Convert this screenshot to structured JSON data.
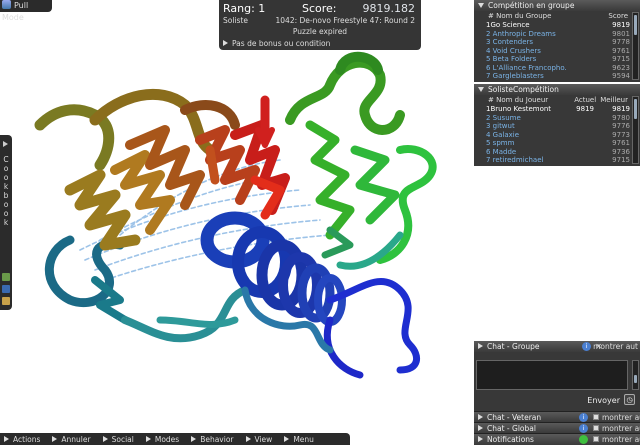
{
  "pull_mode": {
    "label": "Pull Mode"
  },
  "score_panel": {
    "rank": "Rang: 1",
    "score_label": "Score:",
    "score_value": "9819.182",
    "mode": "Soliste",
    "puzzle": "1042: De-novo Freestyle 47: Round 2",
    "status": "Puzzle expired",
    "bonus": "Pas de bonus ou condition"
  },
  "group_competition": {
    "title": "Compétition en groupe",
    "col_name": "# Nom du Groupe",
    "col_score": "Score",
    "rows": [
      {
        "name": "1Go Science",
        "score": "9819"
      },
      {
        "name": "2 Anthropic Dreams",
        "score": "9801"
      },
      {
        "name": "3 Contenders",
        "score": "9778"
      },
      {
        "name": "4 Void Crushers",
        "score": "9761"
      },
      {
        "name": "5 Beta Folders",
        "score": "9715"
      },
      {
        "name": "6 L'Alliance Francopho...",
        "score": "9623"
      },
      {
        "name": "7 Gargleblasters",
        "score": "9594"
      }
    ]
  },
  "solo_competition": {
    "title": "SolisteCompétition",
    "col_name": "# Nom du Joueur",
    "col_current": "Actuel",
    "col_best": "Meilleur",
    "rows": [
      {
        "name": "1Bruno Kestemont",
        "current": "9819",
        "best": "9819"
      },
      {
        "name": "2 Susume",
        "current": "",
        "best": "9780"
      },
      {
        "name": "3 gitwut",
        "current": "",
        "best": "9776"
      },
      {
        "name": "4 Galaxie",
        "current": "",
        "best": "9773"
      },
      {
        "name": "5 spmm",
        "current": "",
        "best": "9761"
      },
      {
        "name": "6 Madde",
        "current": "",
        "best": "9736"
      },
      {
        "name": "7 retiredmichael",
        "current": "",
        "best": "9715"
      }
    ]
  },
  "cookbook": {
    "label": "Cookbook"
  },
  "chat_group": {
    "title": "Chat - Groupe",
    "show_all": "montrer aut",
    "send": "Envoyer"
  },
  "chat_bars": [
    {
      "title": "Chat - Veteran",
      "label": "montrer aut"
    },
    {
      "title": "Chat - Global",
      "label": "montrer aut"
    },
    {
      "title": "Notifications",
      "label": "montrer aut"
    }
  ],
  "bottom_menu": [
    "Actions",
    "Annuler",
    "Social",
    "Modes",
    "Behavior",
    "View",
    "Menu"
  ]
}
